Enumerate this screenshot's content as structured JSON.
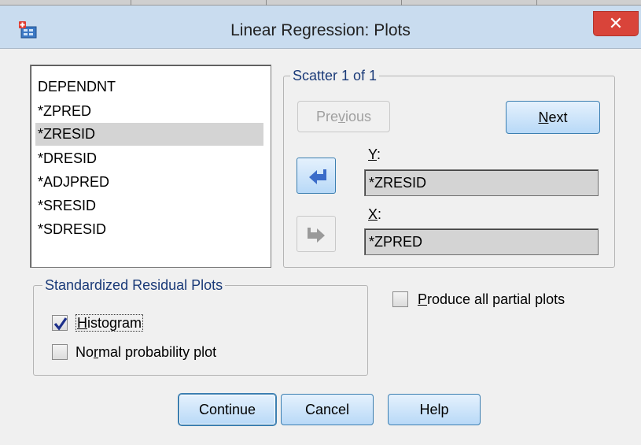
{
  "window": {
    "title": "Linear Regression: Plots",
    "close_glyph": "✕"
  },
  "variables": {
    "items": [
      "DEPENDNT",
      "*ZPRED",
      "*ZRESID",
      "*DRESID",
      "*ADJPRED",
      "*SRESID",
      "*SDRESID"
    ],
    "selected_index": 2
  },
  "scatter": {
    "label": "Scatter 1 of 1",
    "previous_label": "Previous",
    "next_label": "Next",
    "y_label": "Y:",
    "y_value": "*ZRESID",
    "x_label": "X:",
    "x_value": "*ZPRED"
  },
  "standardized": {
    "label": "Standardized Residual Plots",
    "histogram_label": "Histogram",
    "histogram_checked": true,
    "normal_label": "Normal probability plot",
    "normal_checked": false
  },
  "partial": {
    "label": "Produce all partial plots",
    "checked": false
  },
  "buttons": {
    "continue": "Continue",
    "cancel": "Cancel",
    "help": "Help"
  },
  "colors": {
    "title_bar": "#c9dcef",
    "close_button": "#d9443a",
    "button_accent": "#3c7fb1",
    "arrow_accent": "#3b6cc9"
  }
}
